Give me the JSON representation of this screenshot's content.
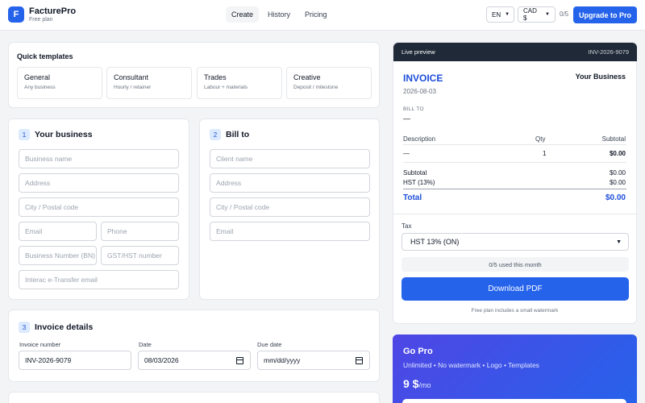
{
  "header": {
    "logo_letter": "F",
    "brand": "FacturePro",
    "plan": "Free plan",
    "nav": [
      {
        "label": "Create",
        "active": true
      },
      {
        "label": "History",
        "active": false
      },
      {
        "label": "Pricing",
        "active": false
      }
    ],
    "language": "EN",
    "currency": "CAD $",
    "usage": "0/5",
    "upgrade_label": "Upgrade to Pro"
  },
  "quick_templates": {
    "title": "Quick templates",
    "items": [
      {
        "name": "General",
        "sub": "Any business"
      },
      {
        "name": "Consultant",
        "sub": "Hourly / retainer"
      },
      {
        "name": "Trades",
        "sub": "Labour + materials"
      },
      {
        "name": "Creative",
        "sub": "Deposit / milestone"
      }
    ]
  },
  "business": {
    "num": "1",
    "title": "Your business",
    "placeholders": {
      "name": "Business name",
      "address": "Address",
      "city": "City / Postal code",
      "email": "Email",
      "phone": "Phone",
      "bn": "Business Number (BN)",
      "gst": "GST/HST number",
      "interac": "Interac e-Transfer email"
    }
  },
  "bill_to": {
    "num": "2",
    "title": "Bill to",
    "placeholders": {
      "name": "Client name",
      "address": "Address",
      "city": "City / Postal code",
      "email": "Email"
    }
  },
  "invoice_details": {
    "num": "3",
    "title": "Invoice details",
    "number_label": "Invoice number",
    "number_value": "INV-2026-9079",
    "date_label": "Date",
    "date_value": "08/03/2026",
    "due_label": "Due date",
    "due_placeholder": "mm/dd/yyyy"
  },
  "preview": {
    "bar_label": "Live preview",
    "bar_invoice": "INV-2026-9079",
    "title": "INVOICE",
    "business_name": "Your Business",
    "date": "2026-08-03",
    "bill_to_label": "BILL TO",
    "bill_to_value": "—",
    "col_description": "Description",
    "col_qty": "Qty",
    "col_subtotal": "Subtotal",
    "row_description": "—",
    "row_qty": "1",
    "row_subtotal": "$0.00",
    "subtotal_label": "Subtotal",
    "subtotal_value": "$0.00",
    "tax_label": "HST (13%)",
    "tax_value": "$0.00",
    "total_label": "Total",
    "total_value": "$0.00",
    "tax_field_label": "Tax",
    "tax_selected": "HST 13% (ON)",
    "used_text": "0/5 used this month",
    "download_label": "Download PDF",
    "watermark_note": "Free plan includes a small watermark"
  },
  "pro": {
    "title": "Go Pro",
    "features": "Unlimited • No watermark • Logo • Templates",
    "price": "9 $",
    "per": "/mo"
  },
  "colors": {
    "accent": "#2563eb",
    "dark_bar": "#1f2937",
    "pro_start": "#4f46e5"
  }
}
